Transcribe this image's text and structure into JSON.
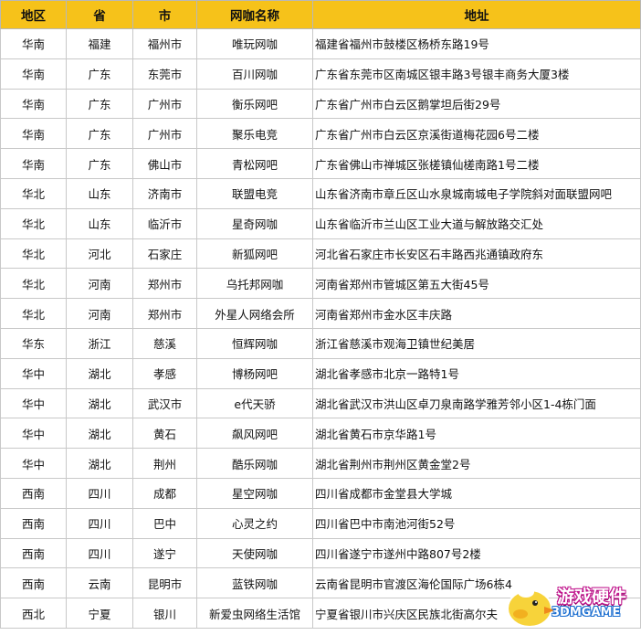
{
  "table": {
    "headers": [
      "地区",
      "省",
      "市",
      "网咖名称",
      "地址"
    ],
    "rows": [
      [
        "华南",
        "福建",
        "福州市",
        "唯玩网咖",
        "福建省福州市鼓楼区杨桥东路19号"
      ],
      [
        "华南",
        "广东",
        "东莞市",
        "百川网咖",
        "广东省东莞市区南城区银丰路3号银丰商务大厦3楼"
      ],
      [
        "华南",
        "广东",
        "广州市",
        "衡乐网吧",
        "广东省广州市白云区鹅掌坦后街29号"
      ],
      [
        "华南",
        "广东",
        "广州市",
        "聚乐电竞",
        "广东省广州市白云区京溪街道梅花园6号二楼"
      ],
      [
        "华南",
        "广东",
        "佛山市",
        "青松网吧",
        "广东省佛山市禅城区张槎镇仙槎南路1号二楼"
      ],
      [
        "华北",
        "山东",
        "济南市",
        "联盟电竞",
        "山东省济南市章丘区山水泉城南城电子学院斜对面联盟网吧"
      ],
      [
        "华北",
        "山东",
        "临沂市",
        "星奇网咖",
        "山东省临沂市兰山区工业大道与解放路交汇处"
      ],
      [
        "华北",
        "河北",
        "石家庄",
        "新狐网吧",
        "河北省石家庄市长安区石丰路西兆通镇政府东"
      ],
      [
        "华北",
        "河南",
        "郑州市",
        "乌托邦网咖",
        "河南省郑州市管城区第五大街45号"
      ],
      [
        "华北",
        "河南",
        "郑州市",
        "外星人网络会所",
        "河南省郑州市金水区丰庆路"
      ],
      [
        "华东",
        "浙江",
        "慈溪",
        "恒辉网咖",
        "浙江省慈溪市观海卫镇世纪美居"
      ],
      [
        "华中",
        "湖北",
        "孝感",
        "博杨网吧",
        "湖北省孝感市北京一路特1号"
      ],
      [
        "华中",
        "湖北",
        "武汉市",
        "e代天骄",
        "湖北省武汉市洪山区卓刀泉南路学雅芳邻小区1-4栋门面"
      ],
      [
        "华中",
        "湖北",
        "黄石",
        "飙风网吧",
        "湖北省黄石市京华路1号"
      ],
      [
        "华中",
        "湖北",
        "荆州",
        "酷乐网咖",
        "湖北省荆州市荆州区黄金堂2号"
      ],
      [
        "西南",
        "四川",
        "成都",
        "星空网咖",
        "四川省成都市金堂县大学城"
      ],
      [
        "西南",
        "四川",
        "巴中",
        "心灵之约",
        "四川省巴中市南池河街52号"
      ],
      [
        "西南",
        "四川",
        "遂宁",
        "天使网咖",
        "四川省遂宁市遂州中路807号2楼"
      ],
      [
        "西南",
        "云南",
        "昆明市",
        "蓝铁网咖",
        "云南省昆明市官渡区海伦国际广场6栋4"
      ],
      [
        "西北",
        "宁夏",
        "银川",
        "新爱虫网络生活馆",
        "宁夏省银川市兴庆区民族北街高尔夫"
      ]
    ]
  },
  "watermark": {
    "line1": "游戏硬件",
    "line2": "3DMGAME"
  },
  "colors": {
    "header_bg": "#f6c21a",
    "grid": "#c8c8c8"
  }
}
